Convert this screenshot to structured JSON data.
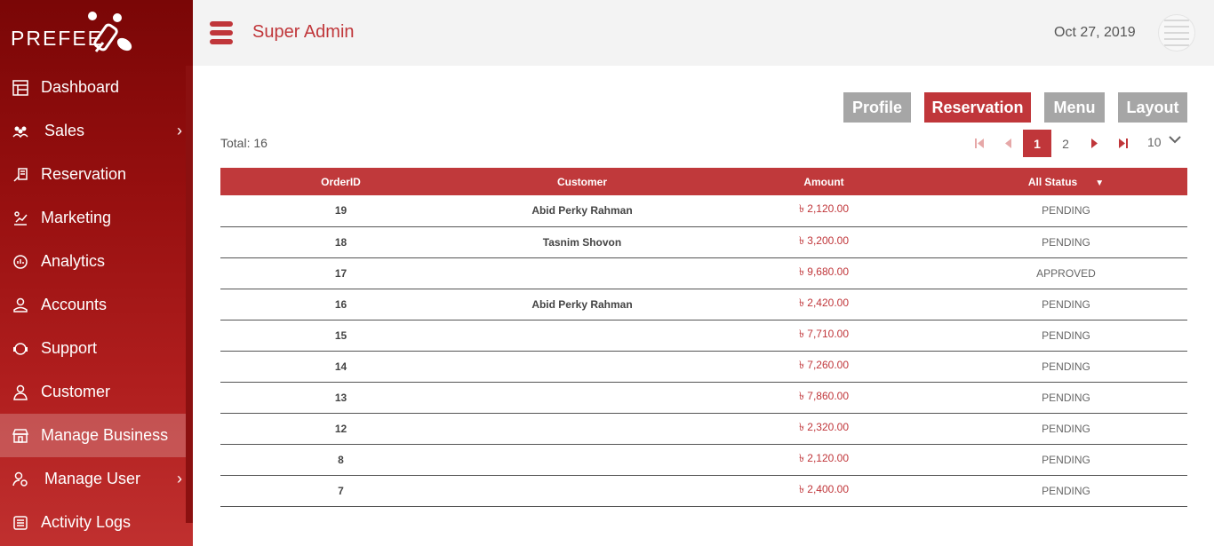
{
  "brand": {
    "name": "PREFEE"
  },
  "sidebar": {
    "items": [
      {
        "label": "Dashboard",
        "icon": "dashboard-icon",
        "chevron": false
      },
      {
        "label": "Sales",
        "icon": "people-icon",
        "chevron": true
      },
      {
        "label": "Reservation",
        "icon": "reservation-icon",
        "chevron": false
      },
      {
        "label": "Marketing",
        "icon": "marketing-icon",
        "chevron": false
      },
      {
        "label": "Analytics",
        "icon": "analytics-icon",
        "chevron": false
      },
      {
        "label": "Accounts",
        "icon": "accounts-icon",
        "chevron": false
      },
      {
        "label": "Support",
        "icon": "support-icon",
        "chevron": false
      },
      {
        "label": "Customer",
        "icon": "customer-icon",
        "chevron": false
      },
      {
        "label": "Manage Business",
        "icon": "store-icon",
        "chevron": false,
        "active": true
      },
      {
        "label": "Manage User",
        "icon": "user-settings-icon",
        "chevron": true
      },
      {
        "label": "Activity Logs",
        "icon": "logs-icon",
        "chevron": false
      }
    ],
    "chevron": "›"
  },
  "header": {
    "title": "Super Admin",
    "date": "Oct 27, 2019"
  },
  "tabs": {
    "profile": "Profile",
    "reservation": "Reservation",
    "menu": "Menu",
    "layout": "Layout"
  },
  "summary": {
    "total": "Total: 16"
  },
  "pagination": {
    "first": "⏮",
    "prev": "◀",
    "pages": [
      "1",
      "2"
    ],
    "current": "1",
    "next": "▶",
    "last": "⏭",
    "page_size": "10"
  },
  "table": {
    "headers": {
      "order_id": "OrderID",
      "customer": "Customer",
      "amount": "Amount",
      "status": "All Status",
      "status_caret": "▼"
    },
    "rows": [
      {
        "order_id": "19",
        "customer": "Abid Perky Rahman",
        "amount": "৳ 2,120.00",
        "status": "PENDING"
      },
      {
        "order_id": "18",
        "customer": "Tasnim Shovon",
        "amount": "৳ 3,200.00",
        "status": "PENDING"
      },
      {
        "order_id": "17",
        "customer": "",
        "amount": "৳ 9,680.00",
        "status": "APPROVED"
      },
      {
        "order_id": "16",
        "customer": "Abid Perky Rahman",
        "amount": "৳ 2,420.00",
        "status": "PENDING"
      },
      {
        "order_id": "15",
        "customer": "",
        "amount": "৳ 7,710.00",
        "status": "PENDING"
      },
      {
        "order_id": "14",
        "customer": "",
        "amount": "৳ 7,260.00",
        "status": "PENDING"
      },
      {
        "order_id": "13",
        "customer": "",
        "amount": "৳ 7,860.00",
        "status": "PENDING"
      },
      {
        "order_id": "12",
        "customer": "",
        "amount": "৳ 2,320.00",
        "status": "PENDING"
      },
      {
        "order_id": "8",
        "customer": "",
        "amount": "৳ 2,120.00",
        "status": "PENDING"
      },
      {
        "order_id": "7",
        "customer": "",
        "amount": "৳ 2,400.00",
        "status": "PENDING"
      }
    ]
  },
  "colors": {
    "accent": "#c0363a",
    "sidebar_top": "#7a0606",
    "sidebar_bottom": "#c0302f",
    "grey_button": "#a6a6a6"
  }
}
